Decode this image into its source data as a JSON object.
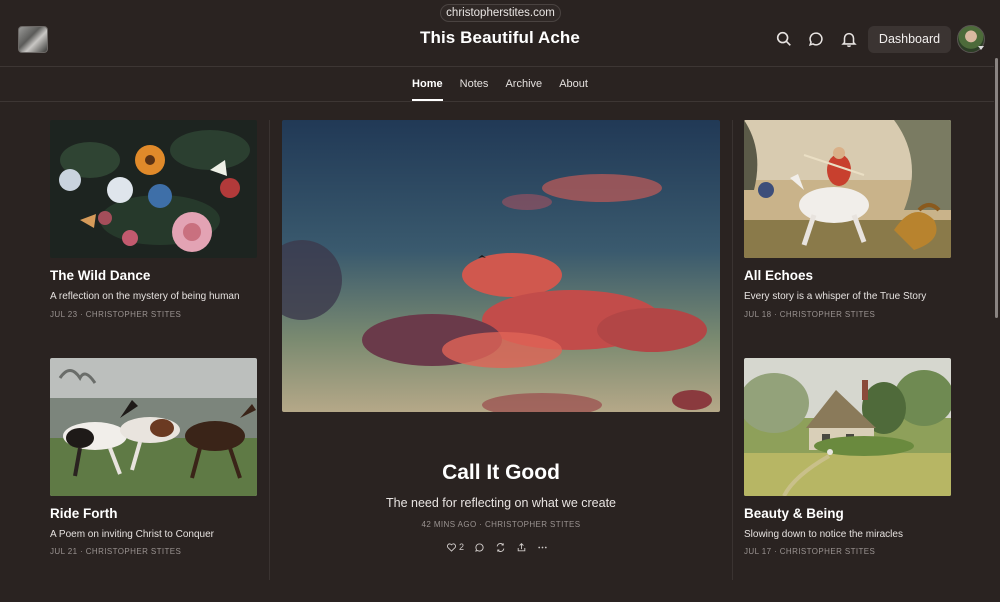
{
  "browser": {
    "url": "christopherstites.com"
  },
  "header": {
    "title": "This Beautiful Ache",
    "dashboard_label": "Dashboard",
    "icons": [
      "search-icon",
      "chat-icon",
      "bell-icon"
    ]
  },
  "nav": {
    "items": [
      {
        "label": "Home",
        "active": true
      },
      {
        "label": "Notes",
        "active": false
      },
      {
        "label": "Archive",
        "active": false
      },
      {
        "label": "About",
        "active": false
      }
    ]
  },
  "posts": {
    "left": [
      {
        "title": "The Wild Dance",
        "subtitle": "A reflection on the mystery of being human",
        "meta": "JUL 23 · CHRISTOPHER STITES"
      },
      {
        "title": "Ride Forth",
        "subtitle": "A Poem on inviting Christ to Conquer",
        "meta": "JUL 21 · CHRISTOPHER STITES"
      }
    ],
    "featured": {
      "title": "Call It Good",
      "subtitle": "The need for reflecting on what we create",
      "meta": "42 MINS AGO · CHRISTOPHER STITES",
      "likes": "2"
    },
    "right": [
      {
        "title": "All Echoes",
        "subtitle": "Every story is a whisper of the True Story",
        "meta": "JUL 18 · CHRISTOPHER STITES"
      },
      {
        "title": "Beauty & Being",
        "subtitle": "Slowing down to notice the miracles",
        "meta": "JUL 17 · CHRISTOPHER STITES"
      }
    ]
  },
  "colors": {
    "background": "#2a2321",
    "text": "#ffffff",
    "meta": "#9a9391",
    "divider": "#3d3634"
  }
}
